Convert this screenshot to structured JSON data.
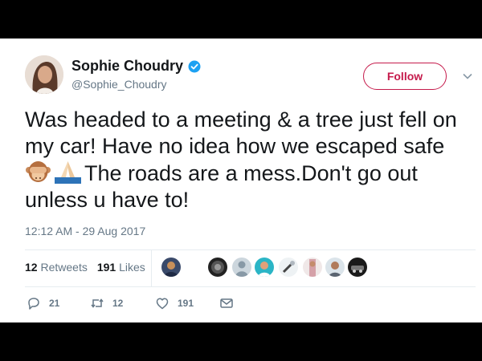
{
  "tweet": {
    "author_name": "Sophie Choudry",
    "author_handle": "@Sophie_Choudry",
    "verified": true,
    "follow_label": "Follow",
    "text_line_1": "Was headed to a meeting & a tree just fell on",
    "text_line_2": "my car! Have no idea how we escaped safe",
    "text_line_3": "The roads are a mess.Don't go out",
    "text_line_4": "unless u have to!",
    "emojis": [
      "see-no-evil-monkey",
      "folded-hands"
    ],
    "timestamp": "12:12 AM - 29 Aug 2017",
    "retweets_count": "12",
    "retweets_label": "Retweets",
    "likes_count": "191",
    "likes_label": "Likes",
    "reply_count": "21",
    "retweet_action_count": "12",
    "like_action_count": "191"
  },
  "icons": {
    "verified": "verified-badge-icon",
    "caret": "chevron-down-icon",
    "reply": "reply-icon",
    "retweet": "retweet-icon",
    "like": "heart-icon",
    "message": "envelope-icon"
  },
  "colors": {
    "follow_accent": "#c51a4b",
    "verified_blue": "#1da1f2",
    "text_primary": "#14171a",
    "text_secondary": "#657786",
    "divider": "#e6ecf0"
  }
}
